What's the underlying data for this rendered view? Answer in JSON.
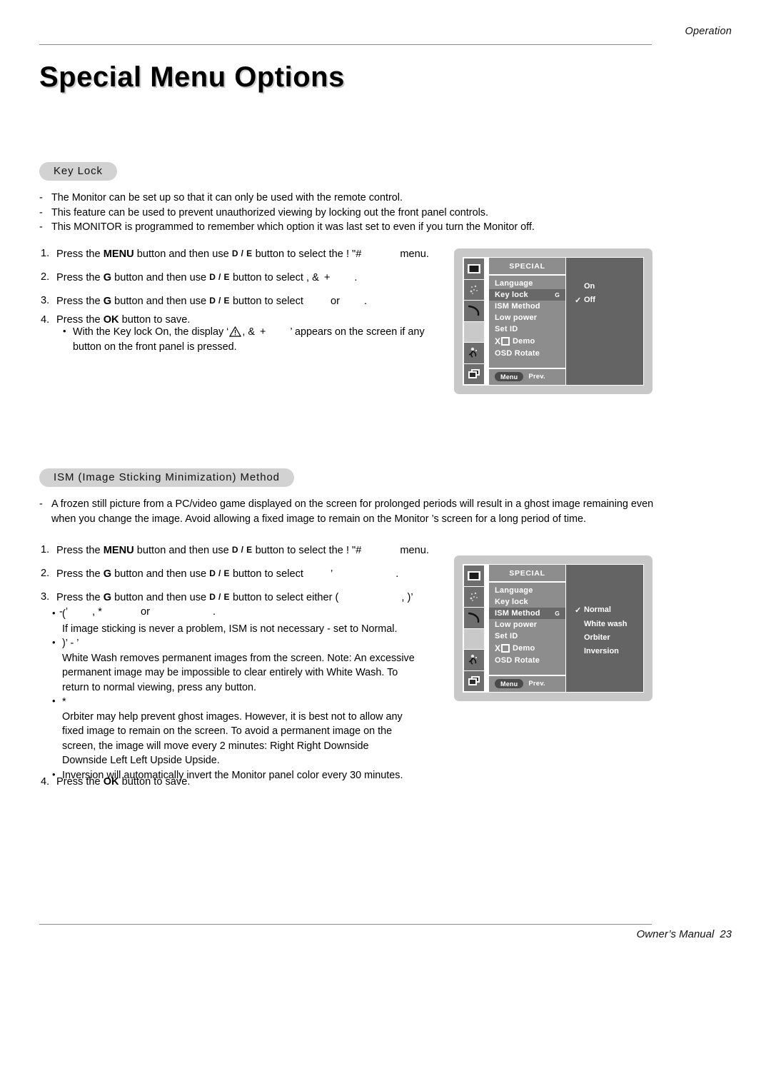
{
  "header": {
    "running_head": "Operation"
  },
  "page_title": "Special Menu Options",
  "sections": [
    {
      "id": "key-lock",
      "heading": "Key Lock",
      "notes": [
        "The Monitor can be set up so that it can only be used with the remote control.",
        "This feature can be used to prevent unauthorized viewing by locking out the front panel controls.",
        "This MONITOR is programmed to remember which option it was last set to even if you turn the Monitor off."
      ],
      "steps": [
        {
          "num": "1.",
          "pre": "Press the ",
          "bold1": "MENU",
          "mid1": " button and then use ",
          "key1": "D",
          "sep": " / ",
          "key2": "E",
          "mid2": " button to select the ",
          "garble1": "! \"#",
          "tail": "menu."
        },
        {
          "num": "2.",
          "pre": "Press the ",
          "bold1": "G",
          "mid1": " button and then use ",
          "key1": "D",
          "sep": " / ",
          "key2": "E",
          "mid2": " button to select ",
          "garble1": ", &",
          "garble2": "+",
          "tail": "."
        },
        {
          "num": "3.",
          "pre": "Press the ",
          "bold1": "G",
          "mid1": " button and then use ",
          "key1": "D",
          "sep": " / ",
          "key2": "E",
          "mid2": " button to select ",
          "garble1": "",
          "tail_or": "or",
          "tail": "."
        },
        {
          "num": "4.",
          "pre": "Press the ",
          "bold1": "OK",
          "mid1": " button to save."
        }
      ],
      "bullets": [
        {
          "dot": "•",
          "text_pre": "With the Key lock On, the display ‘",
          "icon": "warning-triangle-icon",
          "garble": ", &",
          "garble2": "+",
          "text_post": "’ appears on the screen if any",
          "text_line2": "button on the front panel is pressed."
        }
      ],
      "osd": {
        "title": "SPECIAL",
        "items": [
          {
            "label": "Language",
            "selected": false,
            "arrow": "",
            "logo": false
          },
          {
            "label": "Key lock",
            "selected": true,
            "arrow": "G",
            "logo": false
          },
          {
            "label": "ISM Method",
            "selected": false,
            "arrow": "",
            "logo": false
          },
          {
            "label": "Low power",
            "selected": false,
            "arrow": "",
            "logo": false
          },
          {
            "label": "Set ID",
            "selected": false,
            "arrow": "",
            "logo": false
          },
          {
            "label": "Demo",
            "selected": false,
            "arrow": "",
            "logo": true
          },
          {
            "label": "OSD Rotate",
            "selected": false,
            "arrow": "",
            "logo": false
          }
        ],
        "footer": {
          "menu": "Menu",
          "prev": "Prev."
        },
        "options": [
          {
            "label": "On",
            "checked": false
          },
          {
            "label": "Off",
            "checked": true
          }
        ],
        "icons": [
          "picture-icon",
          "sparkle-icon",
          "sound-crescent-icon",
          "blank-selected-icon",
          "special-flower-icon",
          "screen-layers-icon"
        ]
      }
    },
    {
      "id": "ism-method",
      "heading": "ISM (Image Sticking Minimization) Method",
      "notes": [
        "A frozen still picture from a PC/video game displayed on the screen for prolonged periods will result in a ghost image remaining even when you change the image. Avoid allowing a fixed image to remain on the Monitor ’s screen for a long period of time."
      ],
      "steps": [
        {
          "num": "1.",
          "pre": "Press the ",
          "bold1": "MENU",
          "mid1": " button and then use ",
          "key1": "D",
          "sep": " / ",
          "key2": "E",
          "mid2": " button to select the ",
          "garble1": "! \"#",
          "tail": "menu."
        },
        {
          "num": "2.",
          "pre": "Press the ",
          "bold1": "G",
          "mid1": " button and then use ",
          "key1": "D",
          "sep": " / ",
          "key2": "E",
          "mid2": " button to select ",
          "garble1": "’",
          "tail": "."
        },
        {
          "num": "3.",
          "pre": "Press the ",
          "bold1": "G",
          "mid1": " button and then use ",
          "key1": "D",
          "sep": " / ",
          "key2": "E",
          "mid2": " button to select either ",
          "garble1": "(",
          "garble2": ", )’",
          "line2_a": "- ’",
          "line2_b": ", *",
          "line2_or": "or",
          "line2_tail": "."
        },
        {
          "num": "4.",
          "pre": "Press the ",
          "bold1": "OK",
          "mid1": " button to save."
        }
      ],
      "bullets": [
        {
          "dot": "•",
          "label": "(",
          "body": "If image sticking is never a problem, ISM is not necessary - set to Normal."
        },
        {
          "dot": "•",
          "label": ")’   - ’",
          "body": "White Wash removes permanent images from the screen. Note: An excessive permanent image may be impossible to clear entirely with White Wash. To return to normal viewing, press any button."
        },
        {
          "dot": "•",
          "label": "*",
          "body": "Orbiter may help prevent ghost images. However, it is best not to allow any fixed image to remain on the screen. To avoid a permanent image on the screen, the image will move every 2 minutes: Right     Right     Downside",
          "body_line2": "Downside     Left     Left     Upside     Upside."
        },
        {
          "dot": "•",
          "label": "",
          "body": "Inversion will automatically invert the Monitor panel color every 30 minutes."
        }
      ],
      "osd": {
        "title": "SPECIAL",
        "items": [
          {
            "label": "Language",
            "selected": false,
            "arrow": "",
            "logo": false
          },
          {
            "label": "Key lock",
            "selected": false,
            "arrow": "",
            "logo": false
          },
          {
            "label": "ISM Method",
            "selected": true,
            "arrow": "G",
            "logo": false
          },
          {
            "label": "Low power",
            "selected": false,
            "arrow": "",
            "logo": false
          },
          {
            "label": "Set ID",
            "selected": false,
            "arrow": "",
            "logo": false
          },
          {
            "label": "Demo",
            "selected": false,
            "arrow": "",
            "logo": true
          },
          {
            "label": "OSD Rotate",
            "selected": false,
            "arrow": "",
            "logo": false
          }
        ],
        "footer": {
          "menu": "Menu",
          "prev": "Prev."
        },
        "options": [
          {
            "label": "Normal",
            "checked": true
          },
          {
            "label": "White wash",
            "checked": false
          },
          {
            "label": "Orbiter",
            "checked": false
          },
          {
            "label": "Inversion",
            "checked": false
          }
        ],
        "icons": [
          "picture-icon",
          "sparkle-icon",
          "sound-crescent-icon",
          "blank-selected-icon",
          "special-flower-icon",
          "screen-layers-icon"
        ]
      }
    }
  ],
  "footer": {
    "manual_label": "Owner’s Manual",
    "page_number": "23"
  },
  "colors": {
    "pill_bg": "#d2d2d2",
    "osd_frame": "#c8c8c8",
    "osd_menu": "#8d8d8d",
    "osd_selected": "#686868",
    "osd_options": "#646464",
    "rule": "#8a8a8a"
  }
}
